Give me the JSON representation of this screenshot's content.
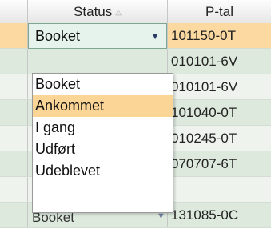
{
  "header": {
    "status_label": "Status",
    "postal_label": "P-tal",
    "sort_icon": "sort-ascending-icon"
  },
  "status_select": {
    "value": "Booket",
    "arrow_icon": "dropdown-arrow-icon"
  },
  "rows": [
    {
      "status": "Booket",
      "postal": "101150-0T"
    },
    {
      "status": "",
      "postal": "010101-6V"
    },
    {
      "status": "",
      "postal": "101040-0T"
    },
    {
      "status": "",
      "postal": "010245-0T"
    },
    {
      "status": "",
      "postal": "070707-6T"
    },
    {
      "status": "Booket",
      "postal": "131085-0C"
    }
  ],
  "dropdown": {
    "options": [
      "Booket",
      "Ankommet",
      "I gang",
      "Udført",
      "Udeblevet"
    ],
    "highlighted": "Ankommet"
  },
  "colors": {
    "selected_row": "#fcd9a0",
    "row_green": "#dde9dd",
    "highlight": "#fbd596"
  }
}
